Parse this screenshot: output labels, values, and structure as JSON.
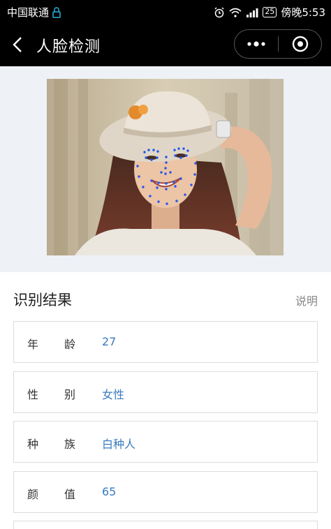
{
  "status_bar": {
    "carrier": "中国联通",
    "battery": "25",
    "time": "傍晚5:53"
  },
  "nav": {
    "title": "人脸检测"
  },
  "result": {
    "title": "识别结果",
    "explain_label": "说明",
    "rows": [
      {
        "label_a": "年",
        "label_b": "龄",
        "value": "27"
      },
      {
        "label_a": "性",
        "label_b": "别",
        "value": "女性"
      },
      {
        "label_a": "种",
        "label_b": "族",
        "value": "白种人"
      },
      {
        "label_a": "颜",
        "label_b": "值",
        "value": "65"
      }
    ]
  },
  "colors": {
    "value_blue": "#3a7abf",
    "landmark_blue": "#2255ee"
  }
}
